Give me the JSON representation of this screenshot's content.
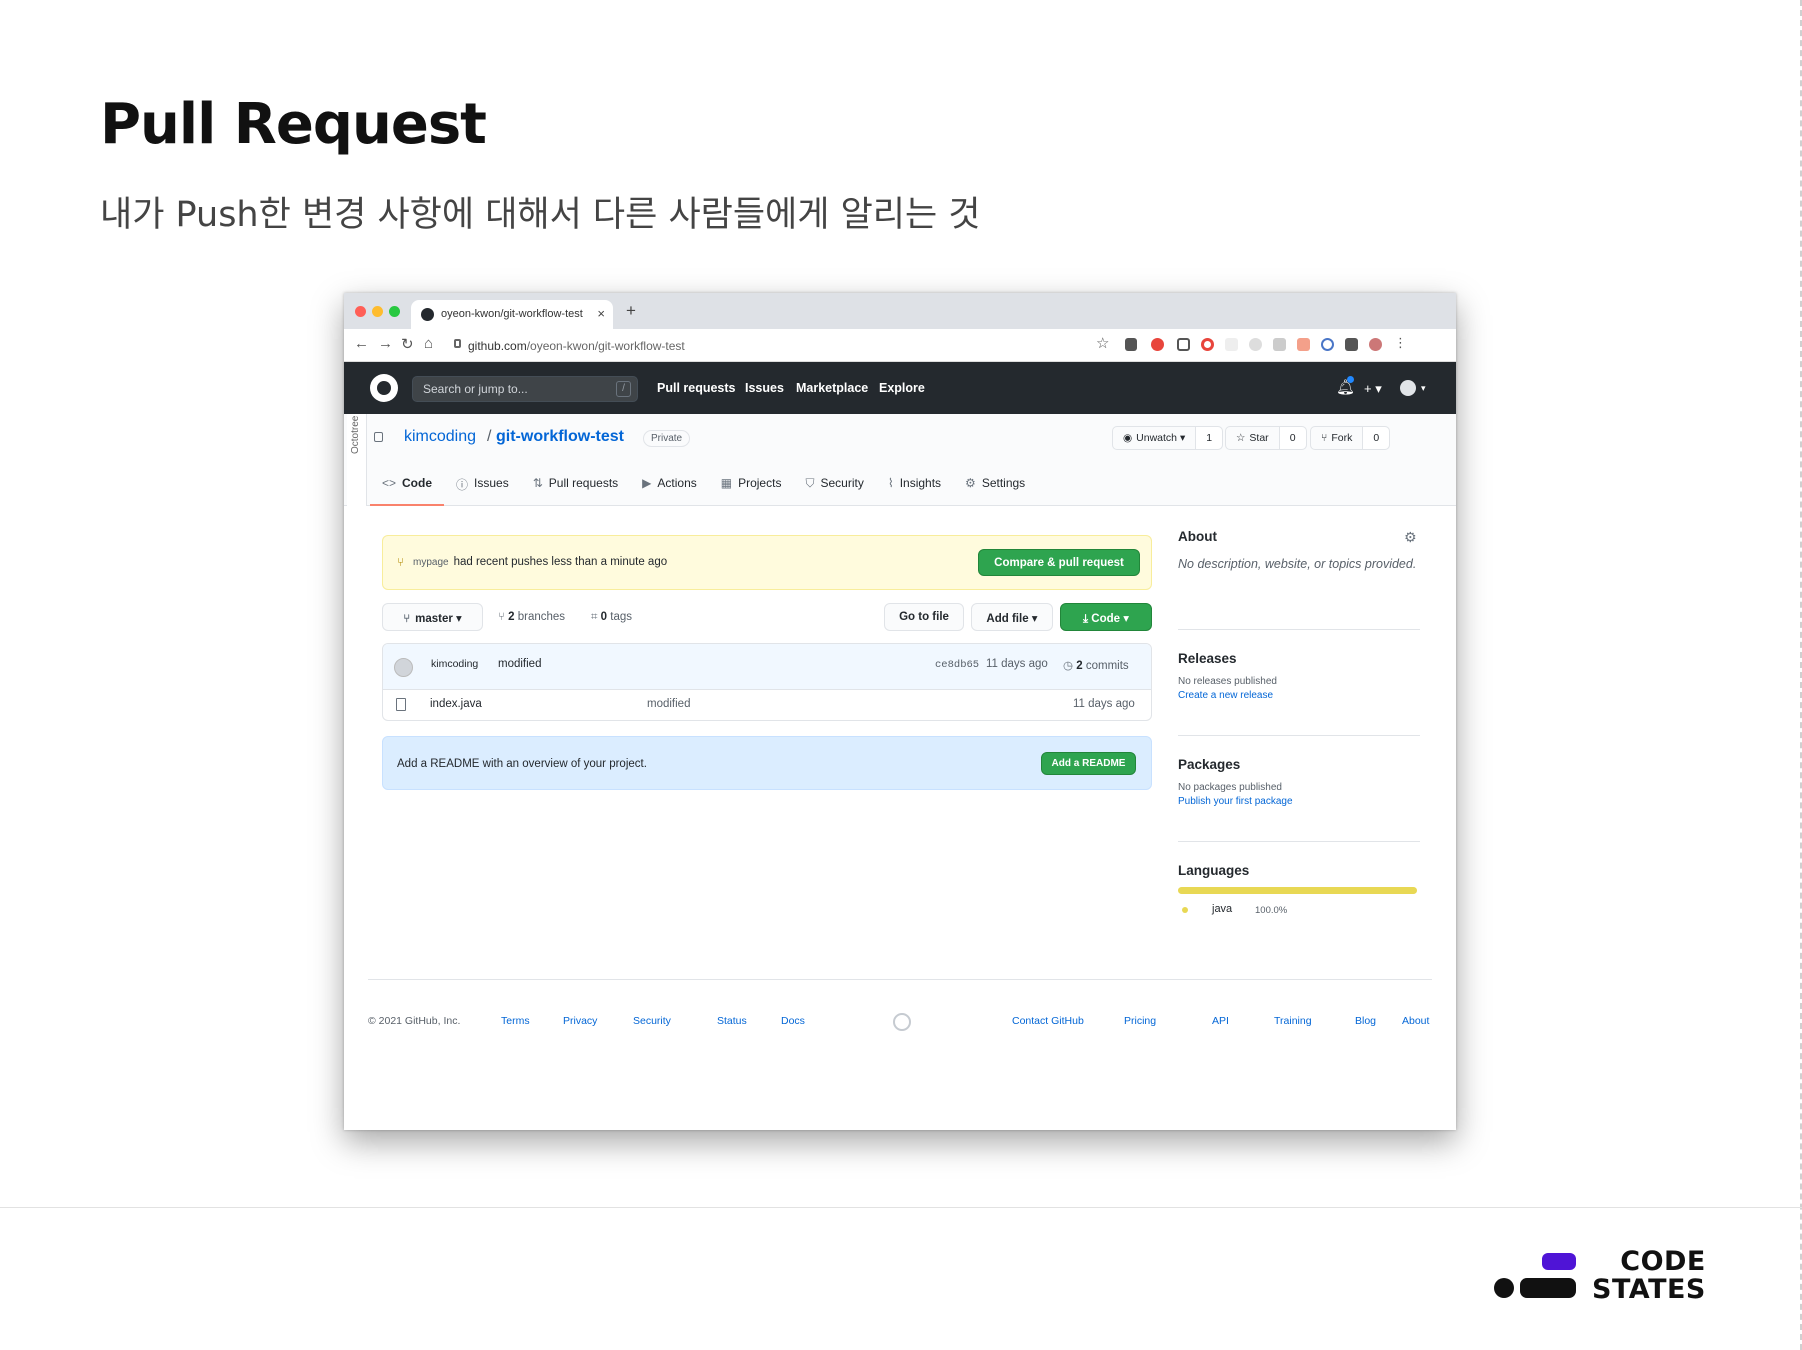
{
  "slide": {
    "title": "Pull Request",
    "subtitle": "내가 Push한 변경 사항에 대해서 다른 사람들에게 알리는 것",
    "logo_line1": "CODE",
    "logo_line2": "STATES"
  },
  "browser": {
    "tab_title": "oyeon-kwon/git-workflow-test",
    "tab_close": "×",
    "new_tab": "+",
    "url_host": "github.com",
    "url_path": "/oyeon-kwon/git-workflow-test"
  },
  "gh_header": {
    "search_placeholder": "Search or jump to...",
    "search_key": "/",
    "nav": [
      "Pull requests",
      "Issues",
      "Marketplace",
      "Explore"
    ],
    "plus": "+ ▾",
    "avatar_caret": "▾"
  },
  "repo": {
    "owner": "kimcoding",
    "separator": "/",
    "name": "git-workflow-test",
    "visibility": "Private",
    "octotree": "Octotree",
    "watch_label": "Unwatch ▾",
    "watch_count": "1",
    "star_label": "Star",
    "star_count": "0",
    "fork_label": "Fork",
    "fork_count": "0",
    "tabs": [
      {
        "icon": "<>",
        "label": "Code"
      },
      {
        "icon": "ⓘ",
        "label": "Issues"
      },
      {
        "icon": "⇅",
        "label": "Pull requests"
      },
      {
        "icon": "▶",
        "label": "Actions"
      },
      {
        "icon": "▦",
        "label": "Projects"
      },
      {
        "icon": "⛉",
        "label": "Security"
      },
      {
        "icon": "⌇",
        "label": "Insights"
      },
      {
        "icon": "⚙",
        "label": "Settings"
      }
    ]
  },
  "flash": {
    "branch": "mypage",
    "message": "had recent pushes less than a minute ago",
    "button": "Compare & pull request"
  },
  "toolbar": {
    "branch": "master ▾",
    "branches_count": "2",
    "branches_label": "branches",
    "tags_count": "0",
    "tags_label": "tags",
    "go_to_file": "Go to file",
    "add_file": "Add file ▾",
    "code": "Code ▾"
  },
  "commit": {
    "author": "kimcoding",
    "message": "modified",
    "sha": "ce8db65",
    "time": "11 days ago",
    "commits_count": "2",
    "commits_label": "commits"
  },
  "files": [
    {
      "name": "index.java",
      "message": "modified",
      "time": "11 days ago"
    }
  ],
  "readme": {
    "text": "Add a README with an overview of your project.",
    "button": "Add a README"
  },
  "sidebar": {
    "about_title": "About",
    "about_text": "No description, website, or topics provided.",
    "releases_title": "Releases",
    "releases_text": "No releases published",
    "releases_link": "Create a new release",
    "packages_title": "Packages",
    "packages_text": "No packages published",
    "packages_link": "Publish your first package",
    "languages_title": "Languages",
    "language_name": "java",
    "language_percent": "100.0%",
    "language_color": "#e8d854"
  },
  "footer": {
    "copyright": "© 2021 GitHub, Inc.",
    "links_left": [
      "Terms",
      "Privacy",
      "Security",
      "Status",
      "Docs"
    ],
    "links_right": [
      "Contact GitHub",
      "Pricing",
      "API",
      "Training",
      "Blog",
      "About"
    ]
  }
}
